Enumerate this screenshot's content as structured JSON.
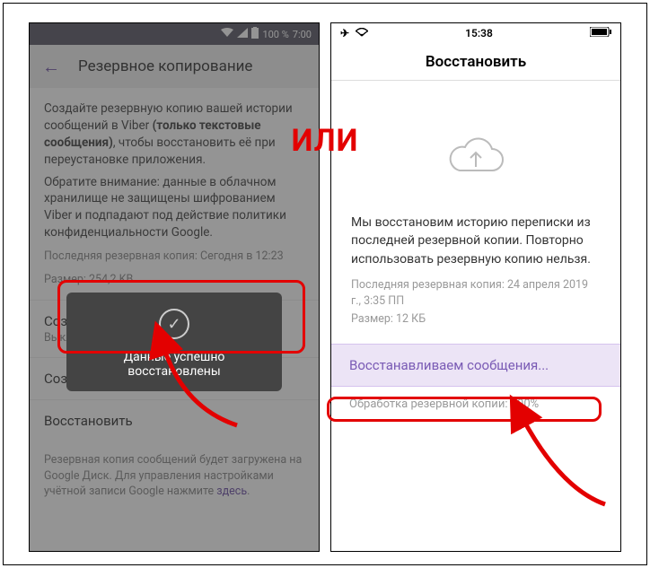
{
  "connector_text": "ИЛИ",
  "android": {
    "status": {
      "battery": "100 %",
      "time": "7:00"
    },
    "title": "Резервное копирование",
    "intro_pre": "Создайте резервную копию вашей истории сообщений в Viber ",
    "intro_bold": "(только текстовые сообщения)",
    "intro_post": ", чтобы восстановить её при переустановке приложения.",
    "intro2": "Обратите внимание: данные в облачном хранилище не защищены шифрованием Viber и подпадают под действие политики конфиденциальности Google.",
    "last_backup": "Последняя резервная копия: Сегодня в 12:23",
    "size": "Размер: 254,2 KB",
    "row_schedule_title": "Создавать резервную копию",
    "row_schedule_sub": "Выкл.",
    "row_create": "Создать копию",
    "row_restore": "Восстановить",
    "footer_pre": "Резервная копия сообщений будет загружена на Google Диск. Для управления настройками учётной записи Google нажмите ",
    "footer_link": "здесь",
    "footer_post": ".",
    "toast_text": "Данные успешно восстановлены"
  },
  "ios": {
    "status": {
      "time": "15:38"
    },
    "title": "Восстановить",
    "body_text": "Мы восстановим историю переписки из последней резервной копии. Повторно использовать резервную копию нельзя.",
    "last_backup": "Последняя резервная копия: 24 апреля 2019 г., 3:35 ПП",
    "size": "Размер: 12 КБ",
    "restoring": "Восстанавливаем сообщения...",
    "progress_label": "Обработка резервной копии: ",
    "progress_value": "100%"
  },
  "colors": {
    "accent_red": "#e30000",
    "viber_purple": "#7a5bb5"
  }
}
